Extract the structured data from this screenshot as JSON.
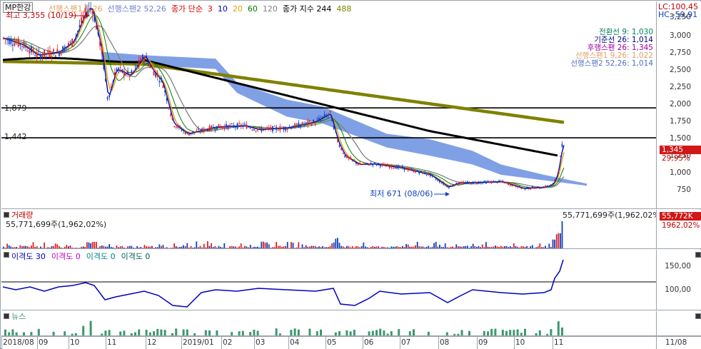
{
  "legend": {
    "code": "MP한강",
    "items": [
      {
        "text": "선행스팬1 9,26",
        "color": "#e0a060"
      },
      {
        "text": "선행스팬2 52,26",
        "color": "#7080d0"
      },
      {
        "text": "종가 단순",
        "color": "#d00000"
      },
      {
        "text": "3",
        "color": "#d00000"
      },
      {
        "text": "10",
        "color": "#0000c0"
      },
      {
        "text": "20",
        "color": "#e0a000"
      },
      {
        "text": "60",
        "color": "#008000"
      },
      {
        "text": "120",
        "color": "#808080"
      },
      {
        "text": "종가 지수 244",
        "color": "#000000"
      },
      {
        "text": "488",
        "color": "#808000"
      }
    ]
  },
  "ichimoku": [
    {
      "text": "전환선 9: 1,030",
      "color": "#008060"
    },
    {
      "text": "기준선 26: 1,014",
      "color": "#000080"
    },
    {
      "text": "후행스팬 26: 1,345",
      "color": "#a000a0"
    },
    {
      "text": "선행스팬1 9,26: 1,022",
      "color": "#e0a060"
    },
    {
      "text": "선행스팬2 52,26: 1,014",
      "color": "#5070c0"
    }
  ],
  "corner": {
    "lc": "LC:100,45",
    "hc": "HC:-59,91"
  },
  "annotations": {
    "high": "최고 3,355 (10/19)",
    "low": "최저 671 (08/06)",
    "line1": "1,879",
    "line2": "1,442"
  },
  "price_axis": [
    "3,250",
    "3,000",
    "2,750",
    "2,500",
    "2,250",
    "2,000",
    "1,750",
    "1,500",
    "1,250",
    "1,000",
    "750"
  ],
  "price_box": {
    "value": "1,345",
    "pct": "29,95%"
  },
  "volume": {
    "title": "거래량",
    "value_left": "55,771,699주(1,962,02%)",
    "value_right": "55,771,699주(1,962,02%)",
    "box_value": "55,772K",
    "box_pct": "1962,02%"
  },
  "disparity": {
    "items": [
      {
        "text": "이격도 30",
        "color": "#0000c0"
      },
      {
        "text": "이격도 0",
        "color": "#c000c0"
      },
      {
        "text": "이격도 0",
        "color": "#008080"
      },
      {
        "text": "이격도 0",
        "color": "#006060"
      }
    ],
    "ticks": [
      "150,00",
      "100,00"
    ]
  },
  "news": {
    "title": "뉴스"
  },
  "x_axis": [
    "2018/08",
    "09",
    "10",
    "11",
    "12",
    "2019/01",
    "02",
    "03",
    "04",
    "05",
    "06",
    "07",
    "08",
    "09",
    "10",
    "11"
  ],
  "x_axis_right": "11/08",
  "colors": {
    "up": "#e02020",
    "down": "#1040c0",
    "cloud": "#6a8fe0",
    "ema244": "#000000",
    "ema488": "#808000",
    "news": "#3a9a6a"
  }
}
